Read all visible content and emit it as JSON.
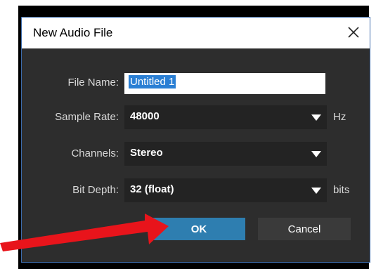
{
  "dialog": {
    "title": "New Audio File",
    "close_icon": "close-icon",
    "fields": {
      "file_name": {
        "label": "File Name:",
        "value": "Untitled 1"
      },
      "sample_rate": {
        "label": "Sample Rate:",
        "value": "48000",
        "unit": "Hz"
      },
      "channels": {
        "label": "Channels:",
        "value": "Stereo"
      },
      "bit_depth": {
        "label": "Bit Depth:",
        "value": "32 (float)",
        "unit": "bits"
      }
    },
    "buttons": {
      "ok": "OK",
      "cancel": "Cancel"
    }
  },
  "annotation": {
    "arrow_color": "#e8141b",
    "points_to": "ok-button"
  },
  "colors": {
    "accent": "#2e7eb0",
    "selection": "#2a7fd4",
    "dialog_bg": "#2d2d2d"
  }
}
